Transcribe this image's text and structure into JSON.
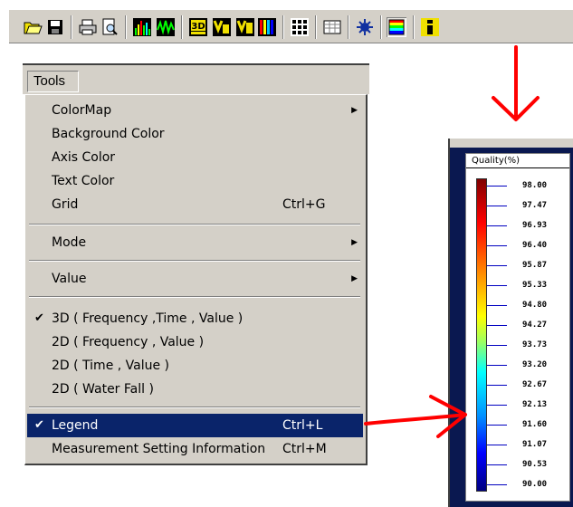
{
  "toolbar": {
    "buttons": [
      {
        "name": "open-icon"
      },
      {
        "name": "save-icon"
      },
      {
        "name": "print-icon"
      },
      {
        "name": "print-preview-icon"
      },
      {
        "name": "spectrum-bars-icon"
      },
      {
        "name": "waveform-icon"
      },
      {
        "name": "view-3d-icon"
      },
      {
        "name": "view-vf-icon"
      },
      {
        "name": "view-vt-icon"
      },
      {
        "name": "waterfall-icon"
      },
      {
        "name": "grid-icon"
      },
      {
        "name": "table-icon"
      },
      {
        "name": "settings-icon"
      },
      {
        "name": "legend-icon"
      },
      {
        "name": "info-icon"
      }
    ],
    "labels": {
      "view3d": "3D"
    }
  },
  "menu": {
    "title": "Tools",
    "items": [
      {
        "label": "ColorMap",
        "submenu": true
      },
      {
        "label": "Background Color"
      },
      {
        "label": "Axis Color"
      },
      {
        "label": "Text Color"
      },
      {
        "label": "Grid",
        "shortcut": "Ctrl+G"
      },
      {
        "label": "Mode",
        "submenu": true
      },
      {
        "label": "Value",
        "submenu": true
      },
      {
        "label": "3D ( Frequency ,Time , Value )",
        "checked": true
      },
      {
        "label": "2D ( Frequency , Value )"
      },
      {
        "label": "2D ( Time , Value )"
      },
      {
        "label": "2D ( Water Fall )"
      },
      {
        "label": "Legend",
        "shortcut": "Ctrl+L",
        "checked": true,
        "selected": true
      },
      {
        "label": "Measurement Setting Information",
        "shortcut": "Ctrl+M"
      }
    ]
  },
  "legend": {
    "title": "Quality(%)",
    "values": [
      "98.00",
      "97.47",
      "96.93",
      "96.40",
      "95.87",
      "95.33",
      "94.80",
      "94.27",
      "93.73",
      "93.20",
      "92.67",
      "92.13",
      "91.60",
      "91.07",
      "90.53",
      "90.00"
    ]
  },
  "colors": {
    "menu_bg": "#d4d0c8",
    "selection": "#0a246a",
    "annotation": "#ff0000",
    "legend_window_bg": "#0a1850"
  }
}
